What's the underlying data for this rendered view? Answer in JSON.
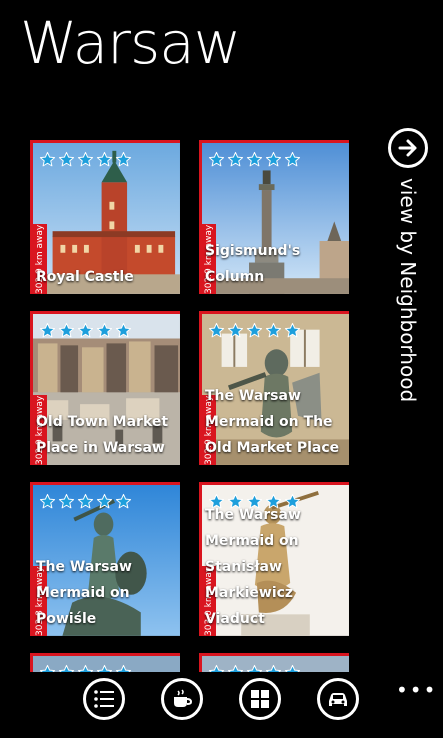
{
  "page": {
    "title": "Warsaw"
  },
  "side_nav": {
    "label": "view by Neighborhood",
    "icon": "arrow-right-icon"
  },
  "attractions": [
    {
      "name": "Royal Castle",
      "distance": "302.9 km away",
      "rating": 5
    },
    {
      "name": "Sigismund's Column",
      "distance": "302.9 km away",
      "rating": 5
    },
    {
      "name": "Old Town Market Place in Warsaw",
      "distance": "302.9 km away",
      "rating": 5
    },
    {
      "name": "The Warsaw Mermaid on The Old Market Place",
      "distance": "302.9 km away",
      "rating": 5
    },
    {
      "name": "The Warsaw Mermaid on Powiśle",
      "distance": "303.8 km away",
      "rating": 5
    },
    {
      "name": "The Warsaw Mermaid on Stanisław Markiewicz Viaduct",
      "distance": "303.0 km away",
      "rating": 5
    }
  ],
  "app_bar": {
    "buttons": [
      {
        "icon": "list-icon"
      },
      {
        "icon": "coffee-cup-icon"
      },
      {
        "icon": "grid-icon"
      },
      {
        "icon": "car-icon"
      }
    ],
    "more": "•••"
  },
  "colors": {
    "accent": "#d9151f",
    "star": "#1e9fdc"
  }
}
